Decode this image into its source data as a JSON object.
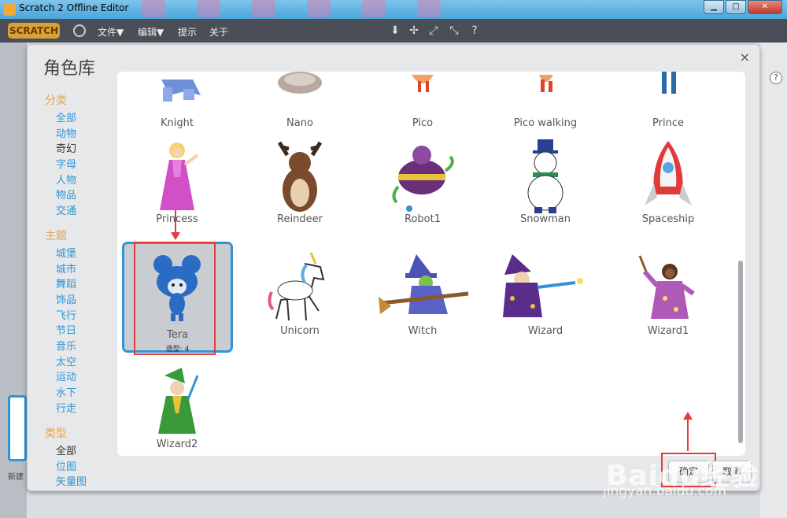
{
  "window": {
    "title": "Scratch 2 Offline Editor"
  },
  "menubar": {
    "logo": "SCRATCH",
    "items": [
      "文件▼",
      "编辑▼",
      "提示",
      "关于"
    ]
  },
  "dialog": {
    "title": "角色库",
    "close": "×",
    "sections": [
      {
        "heading": "分类",
        "items": [
          {
            "label": "全部",
            "active": false
          },
          {
            "label": "动物",
            "active": false
          },
          {
            "label": "奇幻",
            "active": true
          },
          {
            "label": "字母",
            "active": false
          },
          {
            "label": "人物",
            "active": false
          },
          {
            "label": "物品",
            "active": false
          },
          {
            "label": "交通",
            "active": false
          }
        ]
      },
      {
        "heading": "主题",
        "items": [
          {
            "label": "城堡",
            "active": false
          },
          {
            "label": "城市",
            "active": false
          },
          {
            "label": "舞蹈",
            "active": false
          },
          {
            "label": "饰品",
            "active": false
          },
          {
            "label": "飞行",
            "active": false
          },
          {
            "label": "节日",
            "active": false
          },
          {
            "label": "音乐",
            "active": false
          },
          {
            "label": "太空",
            "active": false
          },
          {
            "label": "运动",
            "active": false
          },
          {
            "label": "水下",
            "active": false
          },
          {
            "label": "行走",
            "active": false
          }
        ]
      },
      {
        "heading": "类型",
        "items": [
          {
            "label": "全部",
            "active": true
          },
          {
            "label": "位图",
            "active": false
          },
          {
            "label": "矢量图",
            "active": false
          }
        ]
      }
    ],
    "sprites": [
      {
        "name": "Knight"
      },
      {
        "name": "Nano"
      },
      {
        "name": "Pico"
      },
      {
        "name": "Pico walking"
      },
      {
        "name": "Prince"
      },
      {
        "name": "Princess"
      },
      {
        "name": "Reindeer"
      },
      {
        "name": "Robot1"
      },
      {
        "name": "Snowman"
      },
      {
        "name": "Spaceship"
      },
      {
        "name": "Tera",
        "costumes": "造型: 4",
        "selected": true
      },
      {
        "name": "Unicorn"
      },
      {
        "name": "Witch"
      },
      {
        "name": "Wizard"
      },
      {
        "name": "Wizard1"
      },
      {
        "name": "Wizard2"
      }
    ],
    "ok_button": "确定",
    "cancel_button": "取消"
  },
  "stage_panel": {
    "new_sprite_label": "新建"
  },
  "watermark": {
    "brand": "Baidu经验",
    "url": "jingyan.baidu.com"
  },
  "colors": {
    "accent": "#2f95d6",
    "heading": "#e8a34a",
    "highlight": "#e23b3b",
    "menubar": "#4a4f57"
  }
}
